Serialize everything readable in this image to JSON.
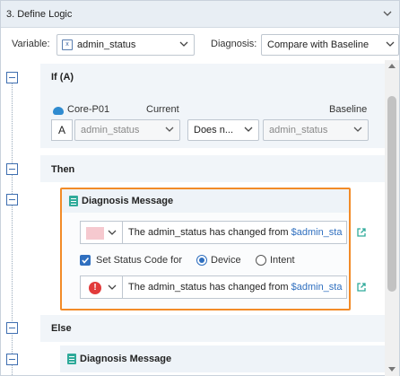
{
  "header": {
    "title": "3. Define Logic"
  },
  "variable_row": {
    "variable_label": "Variable:",
    "variable_value": "admin_status",
    "diagnosis_label": "Diagnosis:",
    "diagnosis_value": "Compare with Baseline"
  },
  "if_section": {
    "title": "If (A)",
    "device": "Core-P01",
    "current_label": "Current",
    "baseline_label": "Baseline",
    "alias": "A",
    "current_value": "admin_status",
    "operator": "Does n...",
    "baseline_value": "admin_status"
  },
  "then_section": {
    "title": "Then",
    "diagnosis_title": "Diagnosis Message",
    "message_prefix": "The admin_status has changed from ",
    "message_var": "$admin_sta",
    "status_check_label": "Set Status Code for",
    "radio_device": "Device",
    "radio_intent": "Intent",
    "status_message_prefix": "The admin_status has changed from ",
    "status_message_var": "$admin_sta"
  },
  "else_section": {
    "title": "Else",
    "diagnosis_title": "Diagnosis Message"
  },
  "colors": {
    "accent": "#2f6fbf",
    "highlight_border": "#f28b28",
    "error": "#e23b3b",
    "swatch": "#f6c9cf"
  },
  "icons": {
    "collapse": "chevron-down-icon",
    "variable": "variable-icon",
    "device": "device-icon",
    "doc": "document-icon",
    "external": "external-link-icon",
    "error": "error-icon"
  }
}
